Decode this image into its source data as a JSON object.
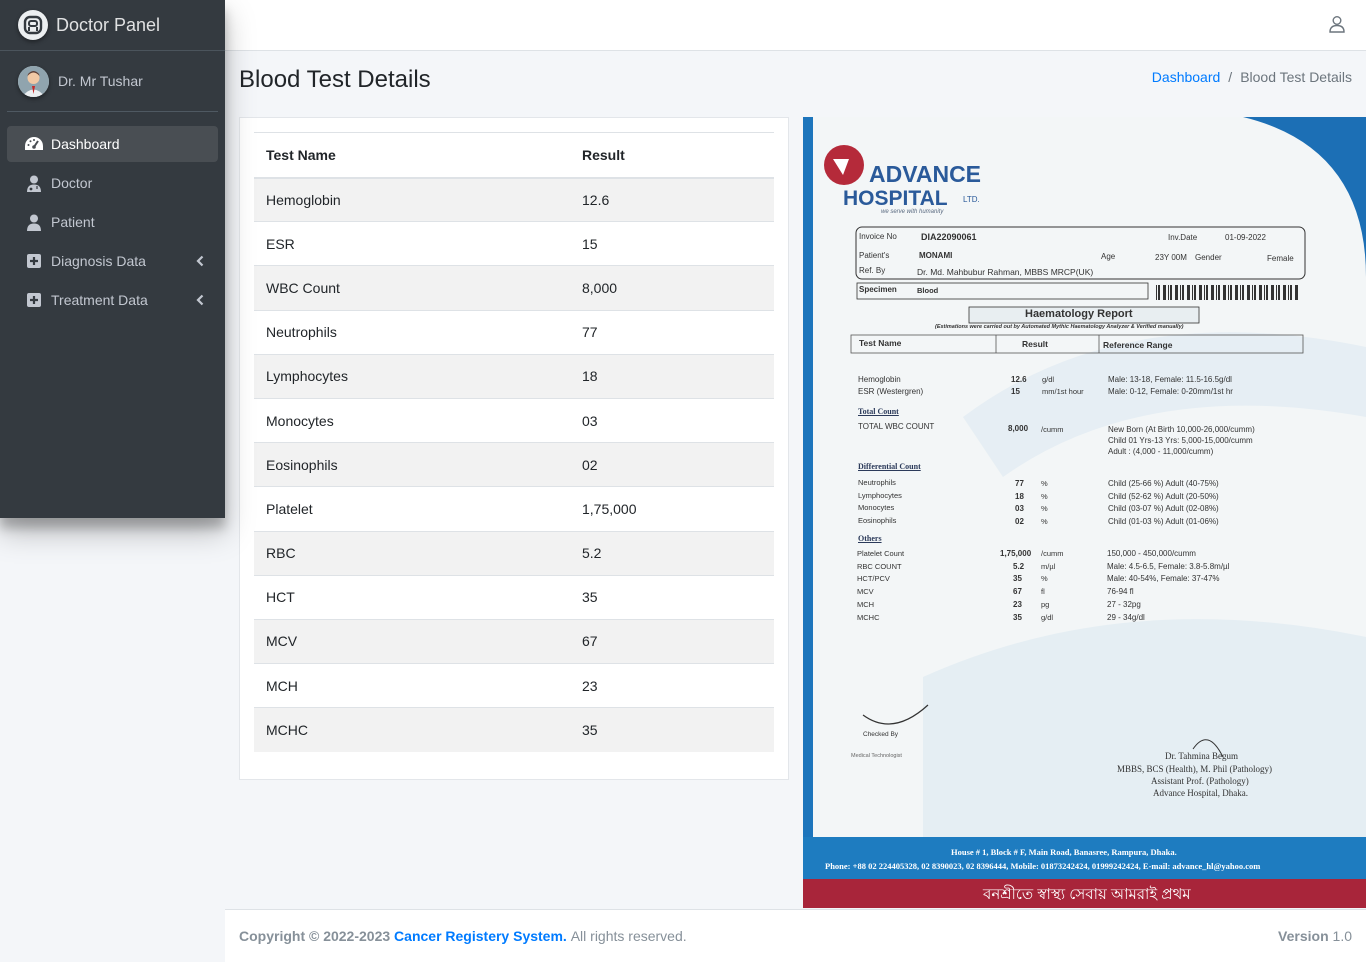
{
  "brand": {
    "title": "Doctor Panel"
  },
  "user": {
    "name": "Dr. Mr Tushar"
  },
  "sidebar": {
    "items": [
      {
        "label": "Dashboard"
      },
      {
        "label": "Doctor"
      },
      {
        "label": "Patient"
      },
      {
        "label": "Diagnosis Data"
      },
      {
        "label": "Treatment Data"
      }
    ]
  },
  "page": {
    "title": "Blood Test Details"
  },
  "breadcrumb": {
    "home": "Dashboard",
    "sep": "/",
    "current": "Blood Test Details"
  },
  "table": {
    "headers": [
      "Test Name",
      "Result"
    ],
    "rows": [
      [
        "Hemoglobin",
        "12.6"
      ],
      [
        "ESR",
        "15"
      ],
      [
        "WBC Count",
        "8,000"
      ],
      [
        "Neutrophils",
        "77"
      ],
      [
        "Lymphocytes",
        "18"
      ],
      [
        "Monocytes",
        "03"
      ],
      [
        "Eosinophils",
        "02"
      ],
      [
        "Platelet",
        "1,75,000"
      ],
      [
        "RBC",
        "5.2"
      ],
      [
        "HCT",
        "35"
      ],
      [
        "MCV",
        "67"
      ],
      [
        "MCH",
        "23"
      ],
      [
        "MCHC",
        "35"
      ]
    ]
  },
  "report": {
    "hospital1": "ADVANCE",
    "hospital2": "HOSPITAL",
    "ltd": "LTD.",
    "tagline": "we serve with humanity",
    "invoice_label": "Invoice No",
    "invoice": "DIA22090061",
    "invdate_label": "Inv.Date",
    "invdate": "01-09-2022",
    "patient_label": "Patient's",
    "patient": "MONAMI",
    "age_label": "Age",
    "age": "23Y 00M",
    "gender_label": "Gender",
    "gender": "Female",
    "refby_label": "Ref. By",
    "refby": "Dr. Md. Mahbubur Rahman, MBBS MRCP(UK)",
    "specimen_label": "Specimen",
    "specimen": "Blood",
    "report_title": "Haematology Report",
    "report_note": "(Estimations were carried out by Automated Mythic Haematology Analyzer & Verified manually)",
    "col_test": "Test Name",
    "col_result": "Result",
    "col_ref": "Reference Range",
    "lines": [
      [
        "Hemoglobin",
        "12.6",
        "g/dl",
        "Male: 13-18, Female: 11.5-16.5g/dl"
      ],
      [
        "ESR (Westergren)",
        "15",
        "mm/1st hour",
        "Male: 0-12, Female: 0-20mm/1st hr"
      ]
    ],
    "total_count": "Total Count",
    "wbc": [
      "TOTAL WBC COUNT",
      "8,000",
      "/cumm",
      "New Born (At Birth 10,000-26,000/cumm)",
      "Child 01 Yrs-13 Yrs: 5,000-15,000/cumm",
      "Adult : (4,000 - 11,000/cumm)"
    ],
    "diff_count": "Differential Count",
    "diff": [
      [
        "Neutrophils",
        "77",
        "%",
        "Child (25-66 %) Adult (40-75%)"
      ],
      [
        "Lymphocytes",
        "18",
        "%",
        "Child (52-62 %) Adult (20-50%)"
      ],
      [
        "Monocytes",
        "03",
        "%",
        "Child (03-07 %) Adult (02-08%)"
      ],
      [
        "Eosinophils",
        "02",
        "%",
        "Child (01-03 %) Adult (01-06%)"
      ]
    ],
    "others": "Others",
    "other_rows": [
      [
        "Platelet Count",
        "1,75,000",
        "/cumm",
        "150,000 - 450,000/cumm"
      ],
      [
        "RBC COUNT",
        "5.2",
        "m/µl",
        "Male: 4.5-6.5, Female: 3.8-5.8m/µl"
      ],
      [
        "HCT/PCV",
        "35",
        "%",
        "Male: 40-54%, Female: 37-47%"
      ],
      [
        "MCV",
        "67",
        "fl",
        "76-94 fl"
      ],
      [
        "MCH",
        "23",
        "pg",
        "27 - 32pg"
      ],
      [
        "MCHC",
        "35",
        "g/dl",
        "29 - 34g/dl"
      ]
    ],
    "checked_by": "Checked By",
    "tech": "Medical Technologist",
    "doctor": "Dr. Tahmina Begum",
    "doc_deg": "MBBS, BCS (Health), M. Phil (Pathology)",
    "doc_pos": "Assistant Prof. (Pathology)",
    "doc_hosp": "Advance Hospital, Dhaka.",
    "address": "House # 1, Block # F, Main Road, Banasree, Rampura, Dhaka.",
    "phone": "Phone: +88 02 224405328, 02 8390023, 02 8396444, Mobile: 01873242424, 01999242424, E-mail: advance_hl@yahoo.com",
    "bangla": "বনশ্রীতে স্বাস্থ্য সেবায় আমরাই প্রথম"
  },
  "footer": {
    "copyright": "Copyright © 2022-2023",
    "site": "Cancer Registery System.",
    "rights": "All rights reserved.",
    "version_label": "Version",
    "version": "1.0"
  },
  "colors": {
    "sidebar": "#343a40",
    "link": "#007bff",
    "active": "#494e53"
  }
}
